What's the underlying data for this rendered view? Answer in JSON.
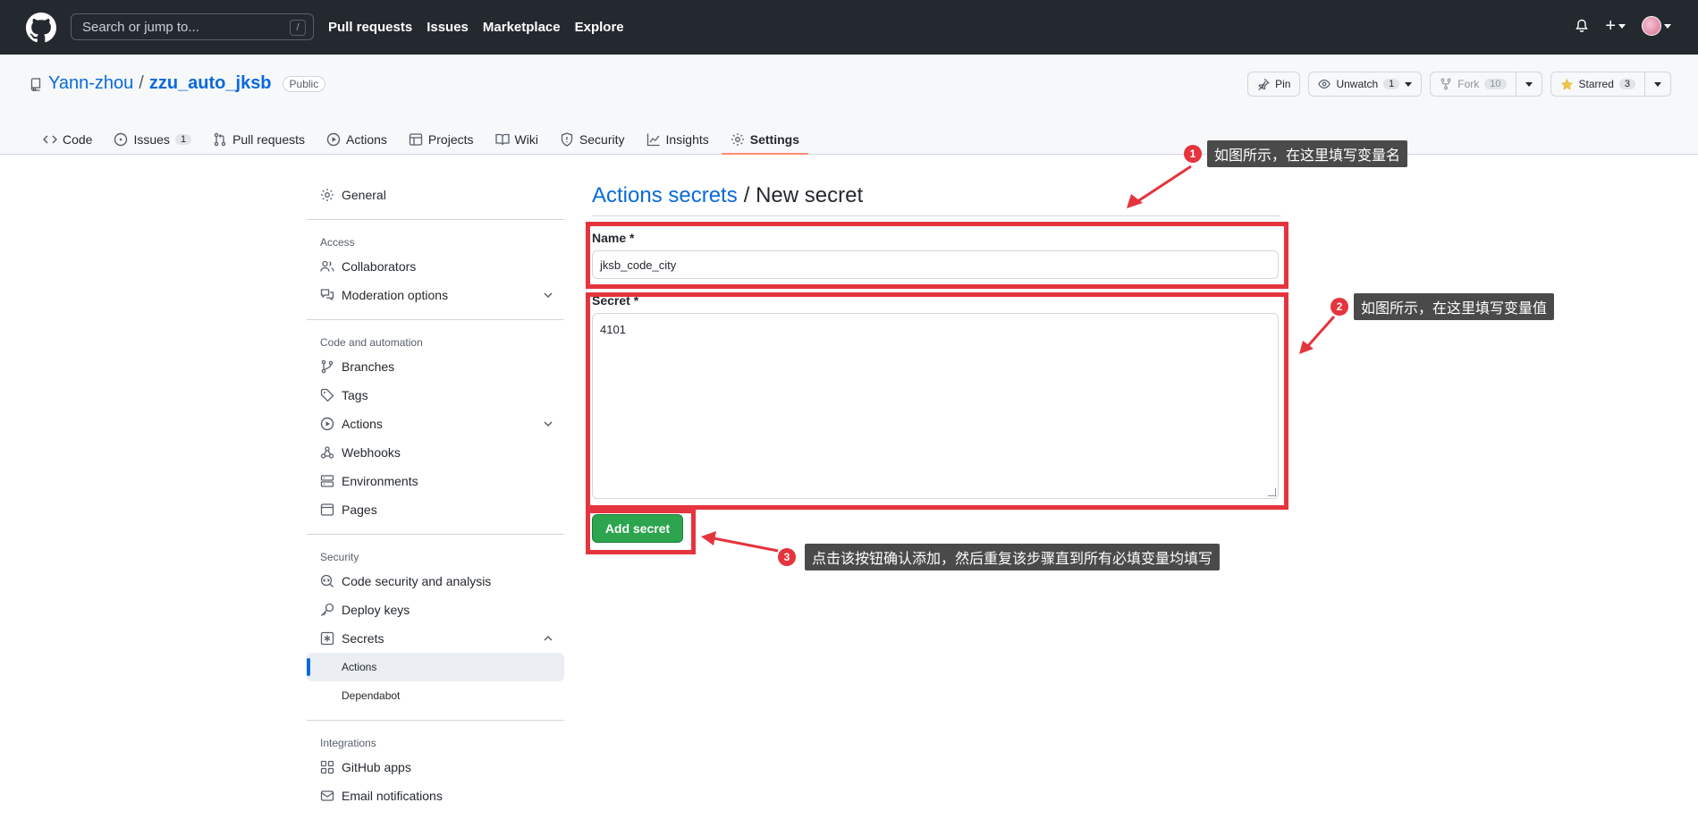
{
  "topbar": {
    "search_placeholder": "Search or jump to...",
    "slash_hint": "/",
    "nav": [
      "Pull requests",
      "Issues",
      "Marketplace",
      "Explore"
    ]
  },
  "repo": {
    "owner": "Yann-zhou",
    "separator": "/",
    "name": "zzu_auto_jksb",
    "visibility": "Public",
    "pin_label": "Pin",
    "unwatch_label": "Unwatch",
    "unwatch_count": "1",
    "fork_label": "Fork",
    "fork_count": "10",
    "starred_label": "Starred",
    "star_count": "3"
  },
  "tabs": [
    {
      "label": "Code",
      "count": ""
    },
    {
      "label": "Issues",
      "count": "1"
    },
    {
      "label": "Pull requests",
      "count": ""
    },
    {
      "label": "Actions",
      "count": ""
    },
    {
      "label": "Projects",
      "count": ""
    },
    {
      "label": "Wiki",
      "count": ""
    },
    {
      "label": "Security",
      "count": ""
    },
    {
      "label": "Insights",
      "count": ""
    },
    {
      "label": "Settings",
      "count": ""
    }
  ],
  "sidebar": {
    "general": "General",
    "access_heading": "Access",
    "collaborators": "Collaborators",
    "moderation": "Moderation options",
    "code_heading": "Code and automation",
    "branches": "Branches",
    "tags": "Tags",
    "actions": "Actions",
    "webhooks": "Webhooks",
    "environments": "Environments",
    "pages": "Pages",
    "security_heading": "Security",
    "code_security": "Code security and analysis",
    "deploy_keys": "Deploy keys",
    "secrets": "Secrets",
    "secrets_actions": "Actions",
    "secrets_dependabot": "Dependabot",
    "integrations_heading": "Integrations",
    "github_apps": "GitHub apps",
    "email_notifications": "Email notifications"
  },
  "main": {
    "title_link": "Actions secrets",
    "title_rest": "/ New secret",
    "name_label": "Name *",
    "name_value": "jksb_code_city",
    "secret_label": "Secret *",
    "secret_value": "4101",
    "submit_label": "Add secret"
  },
  "annotations": [
    {
      "num": "1",
      "text": "如图所示，在这里填写变量名"
    },
    {
      "num": "2",
      "text": "如图所示，在这里填写变量值"
    },
    {
      "num": "3",
      "text": "点击该按钮确认添加，然后重复该步骤直到所有必填变量均填写"
    }
  ],
  "colors": {
    "highlight": "#e5343d",
    "accent": "#0969da",
    "primary_button": "#2da44e"
  }
}
